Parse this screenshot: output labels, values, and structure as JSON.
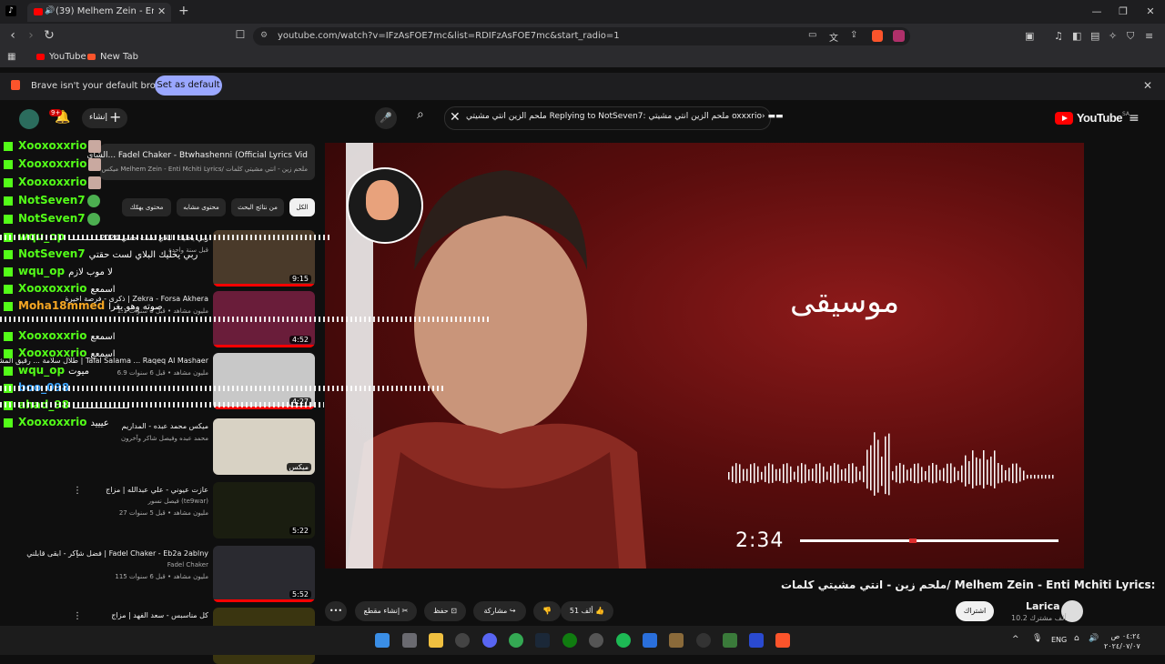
{
  "browser": {
    "tab_title": "(39) Melhem Zein - Enti Mchiti",
    "url": "youtube.com/watch?v=IFzAsFOE7mc&list=RDIFzAsFOE7mc&start_radio=1",
    "bookmarks": [
      {
        "label": "YouTube",
        "icon": "youtube-icon",
        "color": "#ff0000"
      },
      {
        "label": "New Tab",
        "icon": "brave-icon",
        "color": "#fb542b"
      }
    ],
    "infobar_text": "Brave isn't your default browser",
    "set_default_label": "Set as default"
  },
  "youtube": {
    "create_label": "إنشاء",
    "notification_count": "9+",
    "search_query": "ملحم الزين انتي مشيتي Replying to NotSeven7: ملحم الزين انتي مشيتي oxxxrio› ▬▬",
    "logo_text": "YouTube",
    "logo_region": "SA"
  },
  "player": {
    "overlay_title": "موسيقى",
    "overlay_time": "2:34",
    "progress": 0.43
  },
  "video": {
    "title": "ملحم زين - انتي مشيتي كلمات/ Melhem Zein - Enti Mchiti Lyrics:",
    "channel": "Larica",
    "subscribers": "10.2 ألف مشترك",
    "subscribe_label": "اشتراك",
    "likes": "51 ألف",
    "share_label": "مشاركة",
    "save_label": "حفظ",
    "clip_label": "إنشاء مقطع",
    "more_label": "•••"
  },
  "popup": {
    "title": "الشاي... Fadel Chaker - Btwhashenni (Official Lyrics Vid",
    "subtitle": "ميكس Melhem Zein - Enti Mchiti Lyrics/ ملحم زين - انتي مشيتي كلمات"
  },
  "chips": [
    "الكل",
    "من نتائج البحث",
    "محتوى مشابه",
    "محتوى يهمّك"
  ],
  "recommendations": [
    {
      "title": "ربي يخليك البلاي لست حقتي 2024",
      "meta": "قبل سنة واحدة",
      "duration": "9:15",
      "bg": "#4a3a2a"
    },
    {
      "title": "ذكرى - فرصة اخيرة | Zekra - Forsa Akhera",
      "meta": "1.1 مليون مشاهد • قبل 3 سنوات",
      "duration": "4:52",
      "bg": "#6a1d3a"
    },
    {
      "title": "طلال سلامة ... رقيق المشاعر | Talal Salama ... Raqeq Al Mashaer",
      "meta": "6.9 مليون مشاهد • قبل 6 سنوات",
      "duration": "4:27",
      "bg": "#c8c8c8"
    },
    {
      "title": "ميكس محمد عبده - المداريم",
      "meta": "محمد عبده وفيصل شاكر وآخرون",
      "duration": "ميكس",
      "bg": "#d8d2c4"
    },
    {
      "title": "عازت عيوني - علي عبدالله | مزاج",
      "meta": "27 مليون مشاهد • قبل 5 سنوات",
      "channel": "فيصل نسور (te9war)",
      "duration": "5:22",
      "bg": "#1a1d10"
    },
    {
      "title": "فضل شاكر - ابقى قابلني | Fadel Chaker - Eb2a 2ablny",
      "meta": "115 مليون مشاهد • قبل 6 سنوات",
      "channel": "Fadel Chaker",
      "duration": "5:52",
      "bg": "#2a2a30"
    },
    {
      "title": "كل مناسبس - سعد الفهد | مزاج",
      "meta": "",
      "duration": "",
      "bg": "#3a3510"
    }
  ],
  "chat": [
    {
      "user": "Xooxoxxrio",
      "color": "#53fc18",
      "msg": ""
    },
    {
      "user": "Xooxoxxrio",
      "color": "#53fc18",
      "msg": ""
    },
    {
      "user": "Xooxoxxrio",
      "color": "#53fc18",
      "msg": ""
    },
    {
      "user": "NotSeven7",
      "color": "#53fc18",
      "msg": ""
    },
    {
      "user": "NotSeven7",
      "color": "#53fc18",
      "msg": ""
    },
    {
      "user": "wqu_op",
      "color": "#53fc18",
      "msg": "ـــــــــــــــــــــ"
    },
    {
      "user": "NotSeven7",
      "color": "#53fc18",
      "msg": "ربي يخليك البلاي لست حقتي"
    },
    {
      "user": "wqu_op",
      "color": "#53fc18",
      "msg": "لا موب لازم"
    },
    {
      "user": "Xooxoxxrio",
      "color": "#53fc18",
      "msg": "اسمعع"
    },
    {
      "user": "Moha18mmed",
      "color": "#f5a623",
      "msg": "صوته وهو يغرا"
    },
    {
      "user": "Xooxoxxrio",
      "color": "#53fc18",
      "msg": "اسمعع"
    },
    {
      "user": "Xooxoxxrio",
      "color": "#53fc18",
      "msg": "اسمعع"
    },
    {
      "user": "wqu_op",
      "color": "#53fc18",
      "msg": "ميوت"
    },
    {
      "user": "boo_098",
      "color": "#3ea6ff",
      "msg": ""
    },
    {
      "user": "ahad_98",
      "color": "#53fc18",
      "msg": "ـــــــــــــــــــــ"
    },
    {
      "user": "Xooxoxxrio",
      "color": "#53fc18",
      "msg": "عيييد"
    }
  ],
  "taskbar": {
    "lang": "ENG",
    "time": "٠٤:٢٤ ص",
    "date": "٢٠٢٤/٠٧/٠٧"
  }
}
